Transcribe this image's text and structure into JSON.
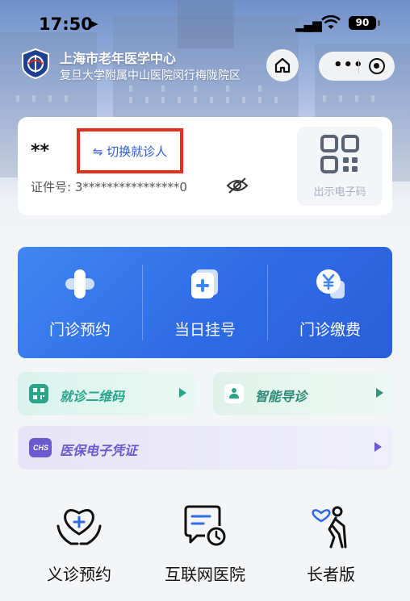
{
  "status_bar": {
    "time": "17:50",
    "location_icon": "location-arrow-icon",
    "signal_icon": "cellular-signal-icon",
    "wifi_icon": "wifi-icon",
    "battery": "90"
  },
  "header": {
    "hospital_name": "上海市老年医学中心",
    "hospital_subtitle": "复旦大学附属中山医院闵行梅陇院区",
    "home_icon": "home-icon",
    "more_icon": "more-dots-icon",
    "close_icon": "target-close-icon"
  },
  "patient": {
    "name": "**",
    "switch_label": "⇋ 切换就诊人",
    "id_label": "证件号:",
    "id_value": "3****************0",
    "eye_icon": "eye-slash-icon",
    "qr_label": "出示电子码",
    "qr_icon": "qr-code-icon"
  },
  "services": [
    {
      "label": "门诊预约",
      "icon": "plus-cross-icon"
    },
    {
      "label": "当日挂号",
      "icon": "register-card-icon"
    },
    {
      "label": "门诊缴费",
      "icon": "payment-yen-icon"
    }
  ],
  "quick_links": {
    "visit_qr": "就诊二维码",
    "smart_guide": "智能导诊",
    "insurance": "医保电子凭证"
  },
  "bottom_items": [
    {
      "label": "义诊预约",
      "icon": "heart-hands-icon"
    },
    {
      "label": "互联网医院",
      "icon": "chat-clock-icon"
    },
    {
      "label": "长者版",
      "icon": "elderly-person-icon"
    }
  ],
  "colors": {
    "accent_blue": "#2f6be6",
    "highlight_red": "#e5301e",
    "teal": "#2aa58a",
    "purple": "#6a5acd"
  }
}
